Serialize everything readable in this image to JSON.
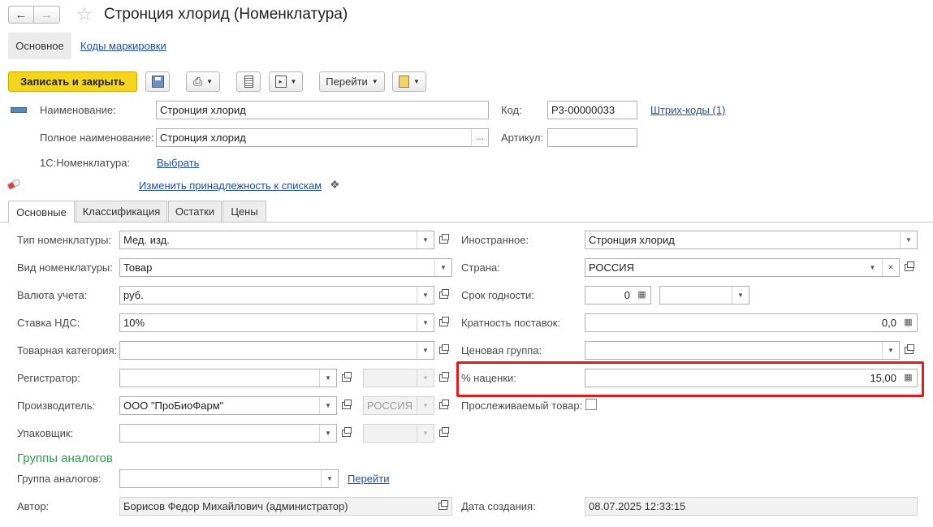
{
  "window": {
    "title": "Стронция хлорид (Номенклатура)"
  },
  "nav": {
    "main_label": "Основное",
    "marking_codes_label": "Коды маркировки"
  },
  "toolbar": {
    "save_close_label": "Записать и закрыть",
    "goto_label": "Перейти"
  },
  "header": {
    "name_label": "Наименование:",
    "name_value": "Стронция хлорид",
    "code_label": "Код:",
    "code_value": "Р3-00000033",
    "barcodes_link": "Штрих-коды (1)",
    "full_name_label": "Полное наименование:",
    "full_name_value": "Стронция хлорид",
    "article_label": "Артикул:",
    "article_value": "",
    "nomenclature_1c_label": "1С:Номенклатура:",
    "select_link": "Выбрать",
    "change_lists_link": "Изменить принадлежность к спискам"
  },
  "tabs": [
    {
      "label": "Основные"
    },
    {
      "label": "Классификация"
    },
    {
      "label": "Остатки"
    },
    {
      "label": "Цены"
    }
  ],
  "left": {
    "type_label": "Тип номенклатуры:",
    "type_value": "Мед. изд.",
    "kind_label": "Вид номенклатуры:",
    "kind_value": "Товар",
    "currency_label": "Валюта учета:",
    "currency_value": "руб.",
    "vat_label": "Ставка НДС:",
    "vat_value": "10%",
    "category_label": "Товарная категория:",
    "category_value": "",
    "registrar_label": "Регистратор:",
    "registrar_value": "",
    "registrar_country": "",
    "manufacturer_label": "Производитель:",
    "manufacturer_value": "ООО \"ПроБиоФарм\"",
    "manufacturer_country": "РОССИЯ",
    "packer_label": "Упаковщик:",
    "packer_value": "",
    "packer_country": ""
  },
  "right": {
    "foreign_label": "Иностранное:",
    "foreign_value": "Стронция хлорид",
    "country_label": "Страна:",
    "country_value": "РОССИЯ",
    "shelf_life_label": "Срок годности:",
    "shelf_life_value": "0",
    "shelf_life_unit": "",
    "multiplicity_label": "Кратность поставок:",
    "multiplicity_value": "0,0",
    "price_group_label": "Ценовая группа:",
    "price_group_value": "",
    "markup_label": "% наценки:",
    "markup_value": "15,00",
    "traceable_label": "Прослеживаемый товар:"
  },
  "analogs": {
    "section_title": "Группы аналогов",
    "group_label": "Группа аналогов:",
    "group_value": "",
    "goto_link": "Перейти"
  },
  "footer": {
    "author_label": "Автор:",
    "author_value": "Борисов Федор Михайлович (администратор)",
    "created_label": "Дата создания:",
    "created_value": "08.07.2025 12:33:15"
  },
  "colors": {
    "accent_yellow": "#f5d51c",
    "highlight_red": "#e01b1b",
    "section_green": "#2e9e52",
    "link_blue": "#1f4fa3"
  }
}
